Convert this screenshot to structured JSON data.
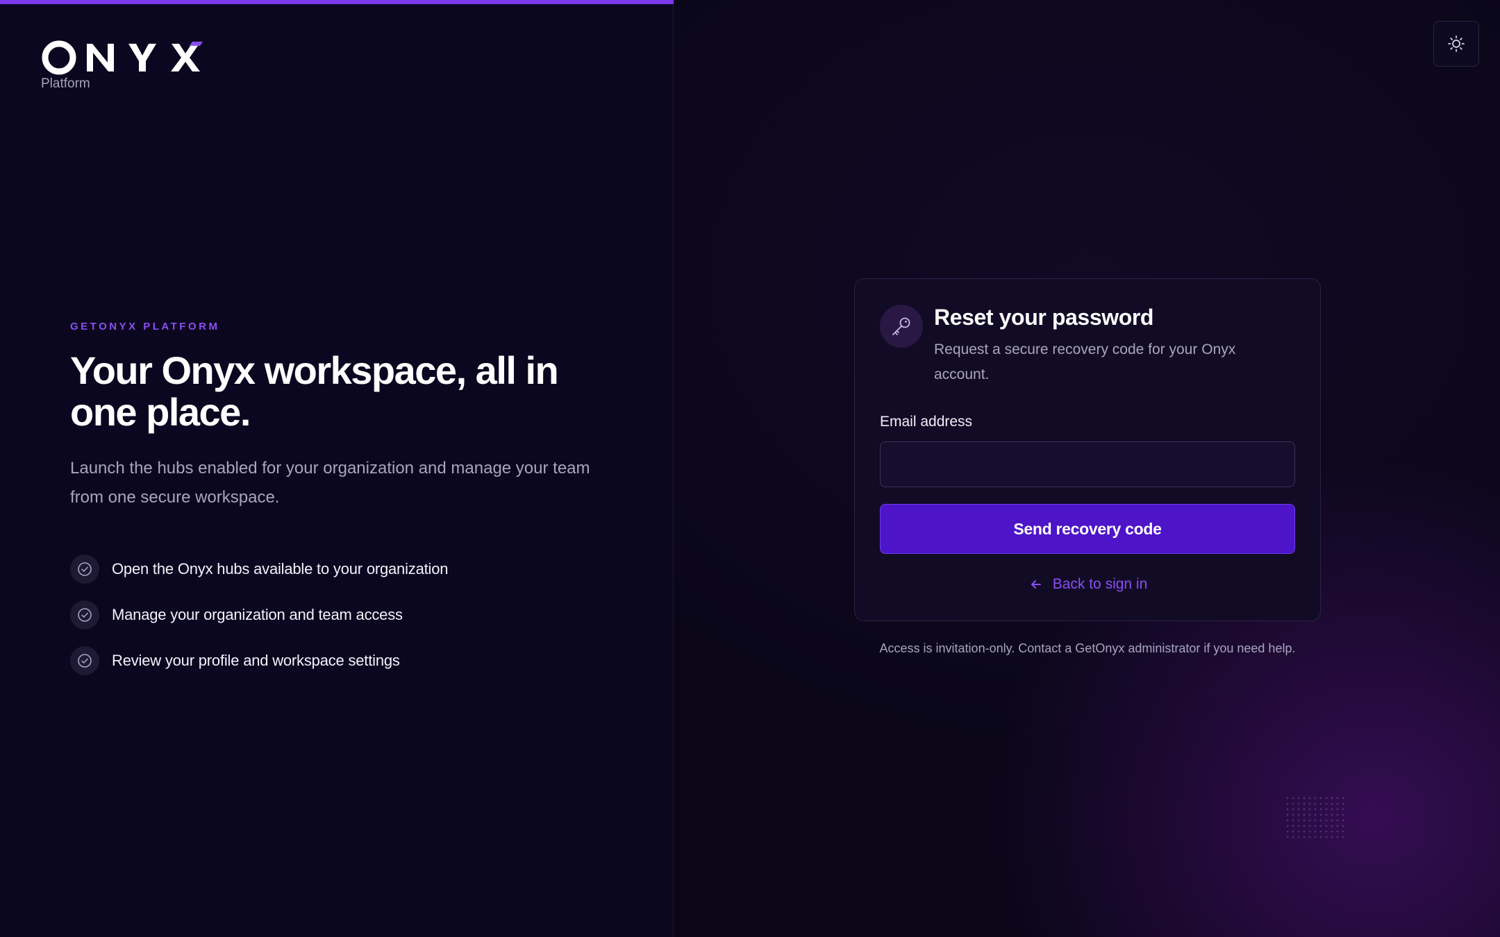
{
  "brand": {
    "name": "ONYX",
    "subtitle": "Platform"
  },
  "hero": {
    "eyebrow": "GETONYX PLATFORM",
    "headline": "Your Onyx workspace, all in one place.",
    "lead": "Launch the hubs enabled for your organization and manage your team from one secure workspace.",
    "features": [
      {
        "icon": "check-circle-icon",
        "text": "Open the Onyx hubs available to your organization"
      },
      {
        "icon": "check-circle-icon",
        "text": "Manage your organization and team access"
      },
      {
        "icon": "check-circle-icon",
        "text": "Review your profile and workspace settings"
      }
    ]
  },
  "theme_toggle": {
    "icon": "sun-icon"
  },
  "reset_card": {
    "icon": "key-icon",
    "title": "Reset your password",
    "description": "Request a secure recovery code for your Onyx account.",
    "email_label": "Email address",
    "email_value": "",
    "email_placeholder": "",
    "submit_label": "Send recovery code",
    "back_icon": "arrow-left-icon",
    "back_label": "Back to sign in"
  },
  "footnote": "Access is invitation-only. Contact a GetOnyx administrator if you need help.",
  "colors": {
    "accent": "#7c3aed",
    "button": "#4d14c8",
    "link": "#8b4ff0",
    "background": "#0a0618"
  }
}
